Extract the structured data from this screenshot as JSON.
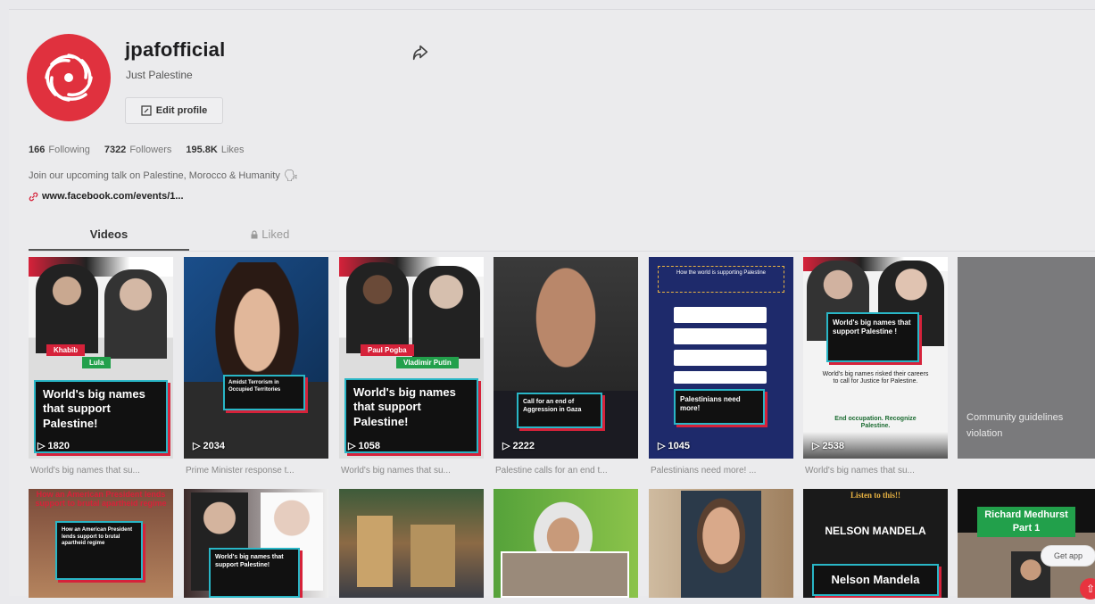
{
  "profile": {
    "username": "jpafofficial",
    "nickname": "Just Palestine",
    "edit_label": "Edit profile",
    "following_count": "166",
    "following_label": "Following",
    "followers_count": "7322",
    "followers_label": "Followers",
    "likes_count": "195.8K",
    "likes_label": "Likes",
    "bio": "Join our upcoming talk on Palestine, Morocco & Humanity",
    "link": "www.facebook.com/events/1..."
  },
  "tabs": [
    {
      "label": "Videos"
    },
    {
      "label": "Liked"
    }
  ],
  "videos_row1": [
    {
      "overlay": "World's big names that support Palestine!",
      "tag1": "Khabib",
      "tag2": "Lula",
      "views": "1820",
      "caption": "World's big names that su..."
    },
    {
      "overlay": "Amidst Terrorism in Occupied Territories",
      "views": "2034",
      "caption": "Prime Minister response t..."
    },
    {
      "overlay": "World's big names that support Palestine!",
      "tag1": "Paul Pogba",
      "tag2": "Vladimir Putin",
      "views": "1058",
      "caption": "World's big names that su..."
    },
    {
      "overlay": "Call for an end of Aggression in Gaza",
      "views": "2222",
      "caption": "Palestine calls for an end t..."
    },
    {
      "header": "How the world is supporting Palestine",
      "overlay": "Palestinians need more!",
      "views": "1045",
      "caption": "Palestinians need more! ..."
    },
    {
      "overlay": "World's big names that support Palestine !",
      "sub1": "World's big names risked their careers to call for Justice for Palestine.",
      "sub2": "End occupation. Recognize Palestine.",
      "views": "2538",
      "caption": "World's big names that su..."
    },
    {
      "overlay": "Community guidelines violation"
    }
  ],
  "videos_row2": [
    {
      "top": "How an American President lends support to brutal apartheid regime",
      "overlay": "How an American President lends support to brutal apartheid regime"
    },
    {
      "overlay": "World's big names that support Palestine!"
    },
    {},
    {},
    {},
    {
      "top": "Listen to this!!",
      "title1": "NELSON MANDELA",
      "overlay": "Nelson Mandela"
    },
    {
      "overlay": "Richard Medhurst Part 1",
      "getapp": "Get app"
    }
  ]
}
